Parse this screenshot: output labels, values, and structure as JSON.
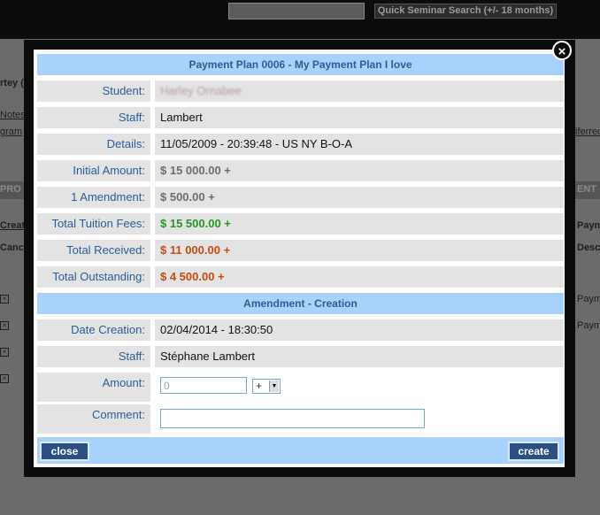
{
  "background": {
    "search_button": "Quick Seminar Search (+/- 18 months)",
    "fragments": {
      "a": "rtey (",
      "b": "Notes",
      "c": "gram",
      "d": "iferred",
      "e": "PRO",
      "f": "ENT",
      "g": "Create",
      "h": "Paym",
      "i": "Cance",
      "j": "Desc",
      "k": "Paym",
      "l": "Paym"
    }
  },
  "modal": {
    "close_icon": "×",
    "title": "Payment Plan 0006 - My Payment Plan I love",
    "rows": {
      "student": {
        "label": "Student:",
        "value": "Harley Ornabee"
      },
      "staff": {
        "label": "Staff:",
        "value": "Lambert"
      },
      "details": {
        "label": "Details:",
        "value": "11/05/2009 - 20:39:48 - US NY B-O-A"
      },
      "initial": {
        "label": "Initial Amount:",
        "value": "$ 15 000.00 +"
      },
      "amendment": {
        "label": "1 Amendment:",
        "value": "$ 500.00 +"
      },
      "tuition": {
        "label": "Total Tuition Fees:",
        "value": "$ 15 500.00 +"
      },
      "received": {
        "label": "Total Received:",
        "value": "$ 11 000.00 +"
      },
      "outstanding": {
        "label": "Total Outstanding:",
        "value": "$ 4 500.00 +"
      }
    },
    "section_title": "Amendment - Creation",
    "creation": {
      "date": {
        "label": "Date Creation:",
        "value": "02/04/2014 - 18:30:50"
      },
      "staff": {
        "label": "Staff:",
        "value": "Stéphane Lambert"
      },
      "amount": {
        "label": "Amount:",
        "value": "0"
      },
      "sign": {
        "selected": "+"
      },
      "comment": {
        "label": "Comment:",
        "value": ""
      }
    },
    "buttons": {
      "close": "close",
      "create": "create"
    }
  }
}
